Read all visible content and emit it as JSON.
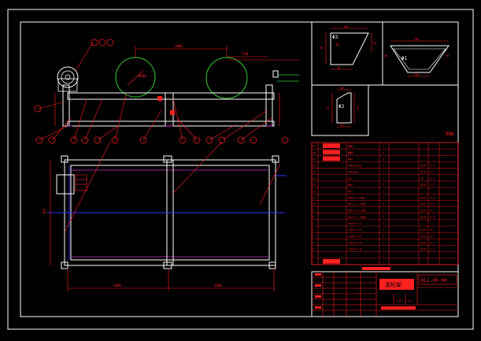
{
  "drawing": {
    "colors": {
      "background": "#000000",
      "border": "#ffffff",
      "part_outline": "#ffffff",
      "dimension": "#ff2020",
      "center_line": "#ff2020",
      "roller": "#33cc33",
      "hidden": "#cc33cc",
      "axis": "#3333ff",
      "table_text": "#ff2020"
    },
    "dimensions": {
      "top_span": "1000",
      "top_right": "250",
      "bottom_left": "1000",
      "bottom_right": "1000",
      "side_height": "365",
      "roller_dia": "Ø400"
    },
    "details": {
      "d1": {
        "label": "Φ3",
        "dim_top": "100",
        "dim_left": "60",
        "dim_right": "70",
        "dim_bottom": "40"
      },
      "d2": {
        "label": "Φ1",
        "dim_top": "200",
        "dim_left": "30",
        "dim_right": "30",
        "dim_bottom": "100"
      },
      "d3": {
        "label": "Φ2",
        "dim_top": "60",
        "dim_left": "70",
        "dim_right": "70",
        "dim_bottom": "50"
      }
    },
    "callouts": {
      "top": [
        "12",
        "13",
        "11",
        "1",
        "2",
        "3",
        "4",
        "5",
        "6",
        "7",
        "8",
        "9",
        "10"
      ],
      "bottom": [
        "14"
      ]
    },
    "parts_list": {
      "header": "明细",
      "rows": [
        {
          "no": "19",
          "code": "",
          "name": "轴承",
          "qty": "2",
          "mat": "",
          "weight": ""
        },
        {
          "no": "18",
          "code": "",
          "name": "螺栓",
          "qty": "4",
          "mat": "",
          "weight": ""
        },
        {
          "no": "17",
          "code": "",
          "name": "Φ40",
          "qty": "2",
          "mat": "",
          "weight": ""
        },
        {
          "no": "16",
          "code": "",
          "name": "Φ40×20×10",
          "qty": "1",
          "mat": "Q235",
          "weight": "2.4"
        },
        {
          "no": "15",
          "code": "",
          "name": "20×20×5",
          "qty": "1",
          "mat": "Q235",
          "weight": "2.1"
        },
        {
          "no": "14",
          "code": "",
          "name": "Φ12",
          "qty": "1",
          "mat": "45",
          "weight": "0.5"
        },
        {
          "no": "13",
          "code": "",
          "name": "Φ40",
          "qty": "2",
          "mat": "Q235",
          "weight": "1.2"
        },
        {
          "no": "12",
          "code": "",
          "name": "Φ25",
          "qty": "2",
          "mat": "",
          "weight": ""
        },
        {
          "no": "11",
          "code": "",
          "name": "Φ40×2 L=100",
          "qty": "2",
          "mat": "Q235",
          "weight": "1.8"
        },
        {
          "no": "10",
          "code": "",
          "name": "Φ32×3 L=1000",
          "qty": "2",
          "mat": "Q235",
          "weight": "4.6"
        },
        {
          "no": "9",
          "code": "",
          "name": "Φ32×3 L=1200",
          "qty": "2",
          "mat": "Q235",
          "weight": "5.2"
        },
        {
          "no": "8",
          "code": "",
          "name": "Φ32×3 L=2000",
          "qty": "2",
          "mat": "Q235",
          "weight": "9.8"
        },
        {
          "no": "7",
          "code": "",
          "name": "40×40 L=1",
          "qty": "2",
          "mat": "",
          "weight": ""
        },
        {
          "no": "6",
          "code": "",
          "name": "L50×5 L=2",
          "qty": "4",
          "mat": "Q235",
          "weight": "3.2"
        },
        {
          "no": "5",
          "code": "",
          "name": "L50×5 L=4",
          "qty": "2",
          "mat": "Q235",
          "weight": "4.1"
        },
        {
          "no": "4",
          "code": "",
          "name": "L50×5 L=6",
          "qty": "2",
          "mat": "Q235",
          "weight": "4.5"
        },
        {
          "no": "3",
          "code": "",
          "name": "L50×5 L=8",
          "qty": "1",
          "mat": "Q235",
          "weight": "3.3"
        },
        {
          "no": "2",
          "code": "",
          "name": "",
          "qty": "1",
          "mat": "",
          "weight": ""
        },
        {
          "no": "1",
          "code": "",
          "name": "",
          "qty": "1",
          "mat": "",
          "weight": ""
        }
      ]
    },
    "title_block": {
      "drawing_name": "滚轮架",
      "drawing_no": "DLJ-00-00",
      "scale": "1:10",
      "sheet": "1/1"
    }
  }
}
